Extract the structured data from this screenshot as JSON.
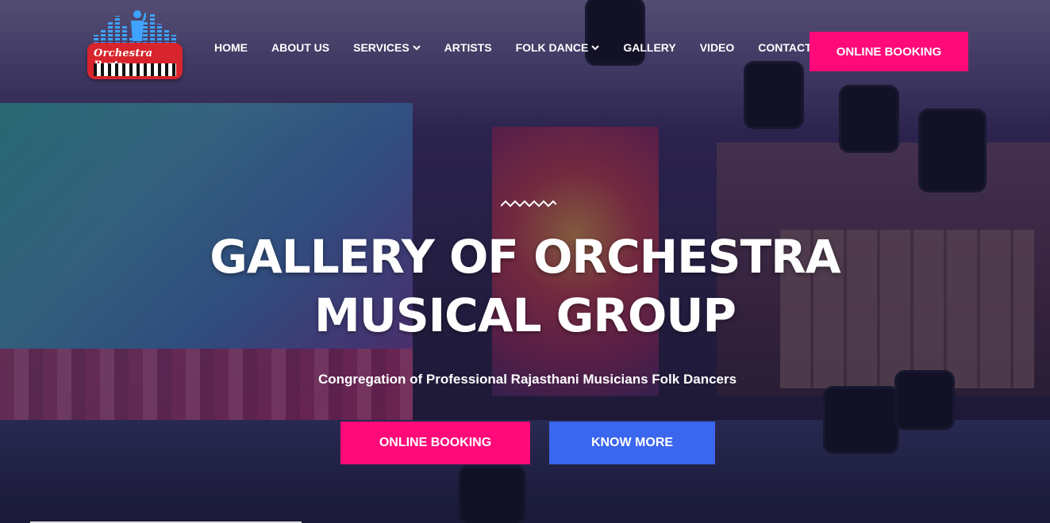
{
  "brand": {
    "logo_text": "Orchestra Party",
    "plate_color": "#d8242c",
    "bars_color": "#3fa3ff"
  },
  "nav": {
    "items": [
      {
        "label": "HOME",
        "dropdown": false
      },
      {
        "label": "ABOUT US",
        "dropdown": false
      },
      {
        "label": "SERVICES",
        "dropdown": true
      },
      {
        "label": "ARTISTS",
        "dropdown": false
      },
      {
        "label": "FOLK DANCE",
        "dropdown": true
      },
      {
        "label": "GALLERY",
        "dropdown": false
      },
      {
        "label": "VIDEO",
        "dropdown": false
      },
      {
        "label": "CONTACT US",
        "dropdown": false
      }
    ],
    "cta_label": "ONLINE BOOKING"
  },
  "hero": {
    "title_line1": "GALLERY OF ORCHESTRA",
    "title_line2": "MUSICAL GROUP",
    "subtitle": "Congregation of Professional Rajasthani Musicians Folk Dancers",
    "primary_button": "ONLINE BOOKING",
    "secondary_button": "KNOW MORE"
  },
  "colors": {
    "accent_pink": "#ff0a78",
    "accent_blue": "#3b66ee"
  }
}
